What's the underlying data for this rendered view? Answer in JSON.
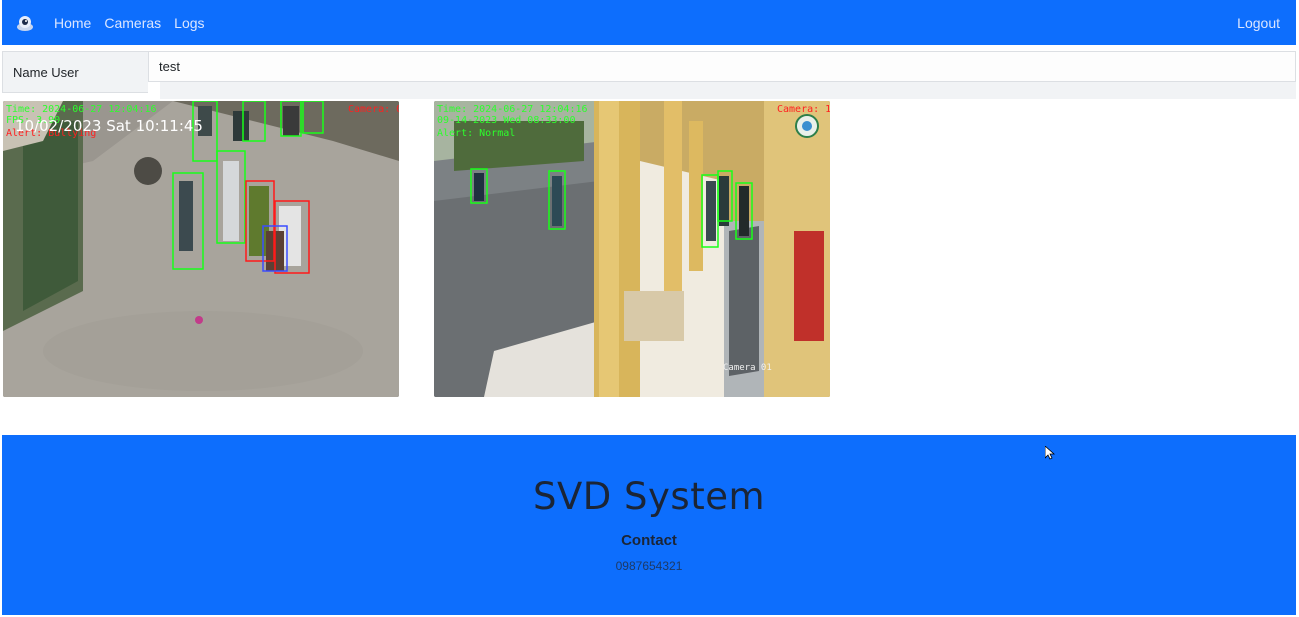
{
  "navbar": {
    "brand_icon": "camera-logo-icon",
    "links": [
      "Home",
      "Cameras",
      "Logs"
    ],
    "logout": "Logout",
    "color": "#0d6efd"
  },
  "user": {
    "label": "Name User",
    "value": "test"
  },
  "cameras": [
    {
      "time_text": "Time: 2024-06-27 12:04:16",
      "fps_text": "FPS: 3.90",
      "alert_text": "Alert: Bullying",
      "datetime_text": "10/02/2023 Sat 10:11:45",
      "camera_text": "Camera: 0"
    },
    {
      "time_text": "Time: 2024-06-27 12:04:16",
      "date_text": "09-14-2023 Wed 08:33:00",
      "alert_text": "Alert: Normal",
      "camera_text": "Camera: 1",
      "corner_text": "Camera 01"
    }
  ],
  "footer": {
    "title": "SVD System",
    "contact": "Contact",
    "phone": "0987654321",
    "color": "#0d6efd"
  }
}
